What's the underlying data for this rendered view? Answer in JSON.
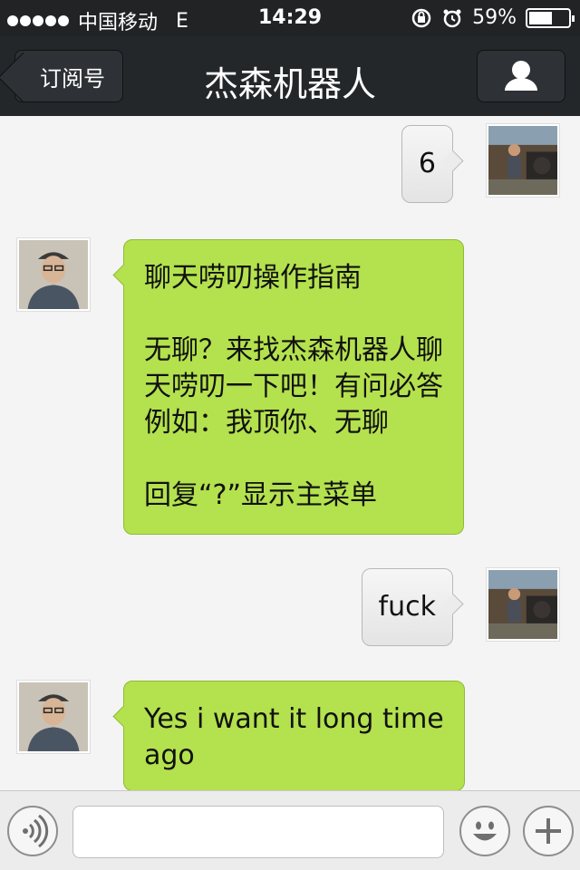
{
  "status_bar": {
    "carrier": "中国移动",
    "network": "E",
    "time": "14:29",
    "battery_percent": "59%",
    "battery_level": 0.59,
    "icons": [
      "signal-dots-icon",
      "orientation-lock-icon",
      "alarm-icon",
      "battery-icon"
    ]
  },
  "nav": {
    "back_label": "订阅号",
    "title": "杰森机器人",
    "profile_icon": "person-icon"
  },
  "messages": [
    {
      "direction": "out",
      "lines": [
        "6"
      ]
    },
    {
      "direction": "in",
      "lines": [
        "聊天唠叨操作指南",
        "",
        "无聊？来找杰森机器人聊",
        "天唠叨一下吧！有问必答",
        "例如：我顶你、无聊",
        "",
        "回复“?”显示主菜单"
      ]
    },
    {
      "direction": "out",
      "lines": [
        "fuck"
      ]
    },
    {
      "direction": "in",
      "lines": [
        "Yes i want it long time",
        "ago"
      ]
    }
  ],
  "input": {
    "value": ""
  },
  "toolbar": {
    "voice_icon": "voice-icon",
    "emoji_icon": "emoji-icon",
    "add_icon": "plus-icon"
  },
  "colors": {
    "incoming_bubble": "#b4e14e",
    "outgoing_bubble": "#e8e8e8",
    "bars": "#24272a"
  }
}
